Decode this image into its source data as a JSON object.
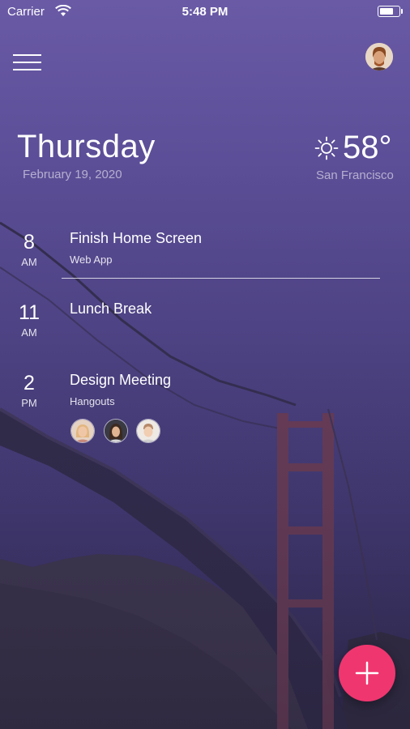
{
  "status_bar": {
    "carrier": "Carrier",
    "time": "5:48 PM",
    "battery_level": 0.8
  },
  "header": {
    "menu_icon": "hamburger-menu-icon",
    "avatar_icon": "user-avatar-icon"
  },
  "today": {
    "day": "Thursday",
    "date": "February 19, 2020"
  },
  "weather": {
    "icon": "sun-icon",
    "temperature": "58°",
    "city": "San Francisco"
  },
  "events": [
    {
      "hour": "8",
      "ampm": "AM",
      "title": "Finish Home Screen",
      "subtitle": "Web App"
    },
    {
      "hour": "11",
      "ampm": "AM",
      "title": "Lunch Break",
      "subtitle": ""
    },
    {
      "hour": "2",
      "ampm": "PM",
      "title": "Design Meeting",
      "subtitle": "Hangouts",
      "attendee_icons": [
        "attendee-avatar-icon",
        "attendee-avatar-icon",
        "attendee-avatar-icon"
      ]
    }
  ],
  "fab": {
    "icon": "plus-icon",
    "color": "#f0366f"
  },
  "background": {
    "description_icon": "golden-gate-bridge-photo"
  }
}
